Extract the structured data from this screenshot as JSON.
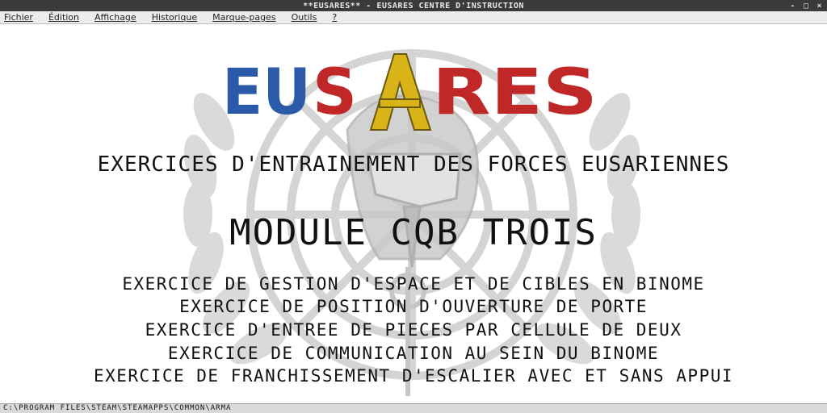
{
  "window": {
    "title": "**EUSARES** - EUSARES CENTRE D'INSTRUCTION",
    "controls": [
      "-",
      "□",
      "×"
    ]
  },
  "menu": [
    "Fichier",
    "Édition",
    "Affichage",
    "Historique",
    "Marque-pages",
    "Outils",
    "?"
  ],
  "logo": {
    "text": "EUSARES",
    "colors": {
      "blue": "#2a5aa8",
      "red": "#c02828",
      "yellow": "#d8b418"
    }
  },
  "content": {
    "subtitle": "EXERCICES D'ENTRAINEMENT DES FORCES EUSARIENNES",
    "module": "MODULE CQB TROIS",
    "exercises": [
      "EXERCICE DE GESTION D'ESPACE ET DE CIBLES EN BINOME",
      "EXERCICE DE POSITION D'OUVERTURE DE PORTE",
      "EXERCICE D'ENTREE DE PIECES PAR CELLULE DE DEUX",
      "EXERCICE DE COMMUNICATION AU SEIN DU BINOME",
      "EXERCICE DE FRANCHISSEMENT D'ESCALIER AVEC ET SANS APPUI"
    ]
  },
  "statusbar": {
    "path": "C:\\PROGRAM FILES\\STEAM\\STEAMAPPS\\COMMON\\ARMA"
  },
  "emblem_icon": "un-laurel-helmet-emblem"
}
